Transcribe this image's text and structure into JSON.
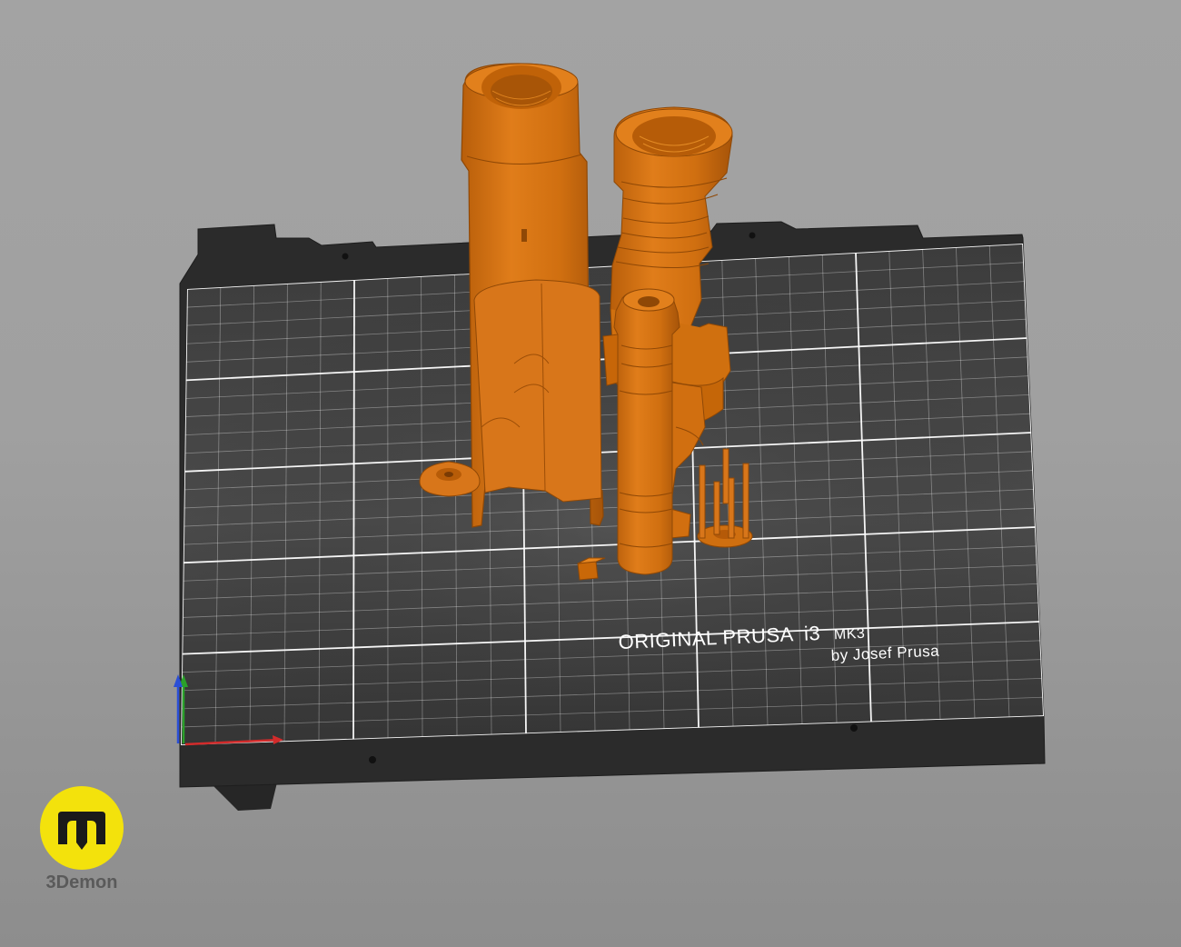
{
  "scene": {
    "background_color": "#a1a1a1",
    "bed_color": "#2b2b2b",
    "sheet_color": "#333333",
    "grid_color": "#ffffff",
    "model_color": "#d4700e",
    "model_shadow_color": "#9c4e07",
    "model_highlight_color": "#f08a25"
  },
  "bed_label": {
    "brand": "ORIGINAL PRUSA",
    "model": "i3",
    "variant": "MK3",
    "author": "by Josef Prusa"
  },
  "axes": {
    "x_color": "#d22b2b",
    "y_color": "#2aa02a",
    "z_color": "#2b4fd6"
  },
  "logo": {
    "name": "3Demon",
    "icon": "3demon-m-icon",
    "color": "#f3e20c"
  }
}
